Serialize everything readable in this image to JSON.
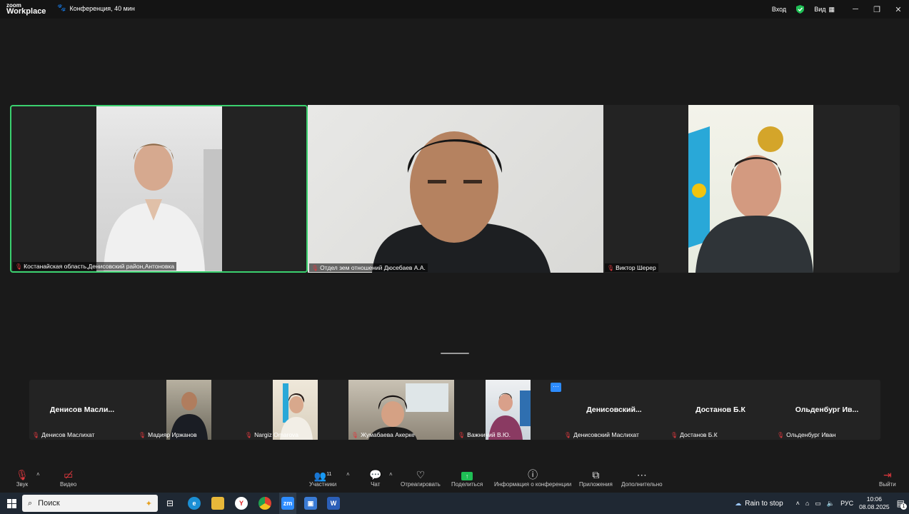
{
  "app": {
    "logo_top": "zoom",
    "logo_bottom": "Workplace",
    "conference_label": "Конференция, 40 мин"
  },
  "titlebar": {
    "signin": "Вход",
    "view": "Вид"
  },
  "main_tiles": [
    {
      "name": "Костанайская область,Денисовский район,Антоновка"
    },
    {
      "name": "Отдел зем отношений Дюсебаев А.А."
    },
    {
      "name": "Виктор Шерер"
    }
  ],
  "strip": [
    {
      "big": "Денисов Масли...",
      "name": "Денисов Маслихат"
    },
    {
      "big": "",
      "name": "Мадияр Иржанов"
    },
    {
      "big": "",
      "name": "Nargiz Omarova"
    },
    {
      "big": "",
      "name": "Жумабаева Акерке"
    },
    {
      "big": "",
      "name": "Важничий В.Ю."
    },
    {
      "big": "Денисовский...",
      "name": "Денисовский Маслихат"
    },
    {
      "big": "Достанов Б.К",
      "name": "Достанов Б.К"
    },
    {
      "big": "Ольденбург Ив...",
      "name": "Ольденбург Иван"
    }
  ],
  "toolbar": {
    "audio": "Звук",
    "video": "Видео",
    "participants": "Участники",
    "participants_count": "11",
    "chat": "Чат",
    "react": "Отреагировать",
    "share": "Поделиться",
    "info": "Информация о конференции",
    "apps": "Приложения",
    "more": "Дополнительно",
    "leave": "Выйти"
  },
  "taskbar": {
    "search": "Поиск",
    "weather": "Rain to stop",
    "lang": "РУС",
    "time": "10:06",
    "date": "08.08.2025",
    "notif_count": "1"
  },
  "colors": {
    "active_border": "#3bd16f",
    "mic_off": "#e0383e",
    "share_green": "#1fbf55"
  }
}
